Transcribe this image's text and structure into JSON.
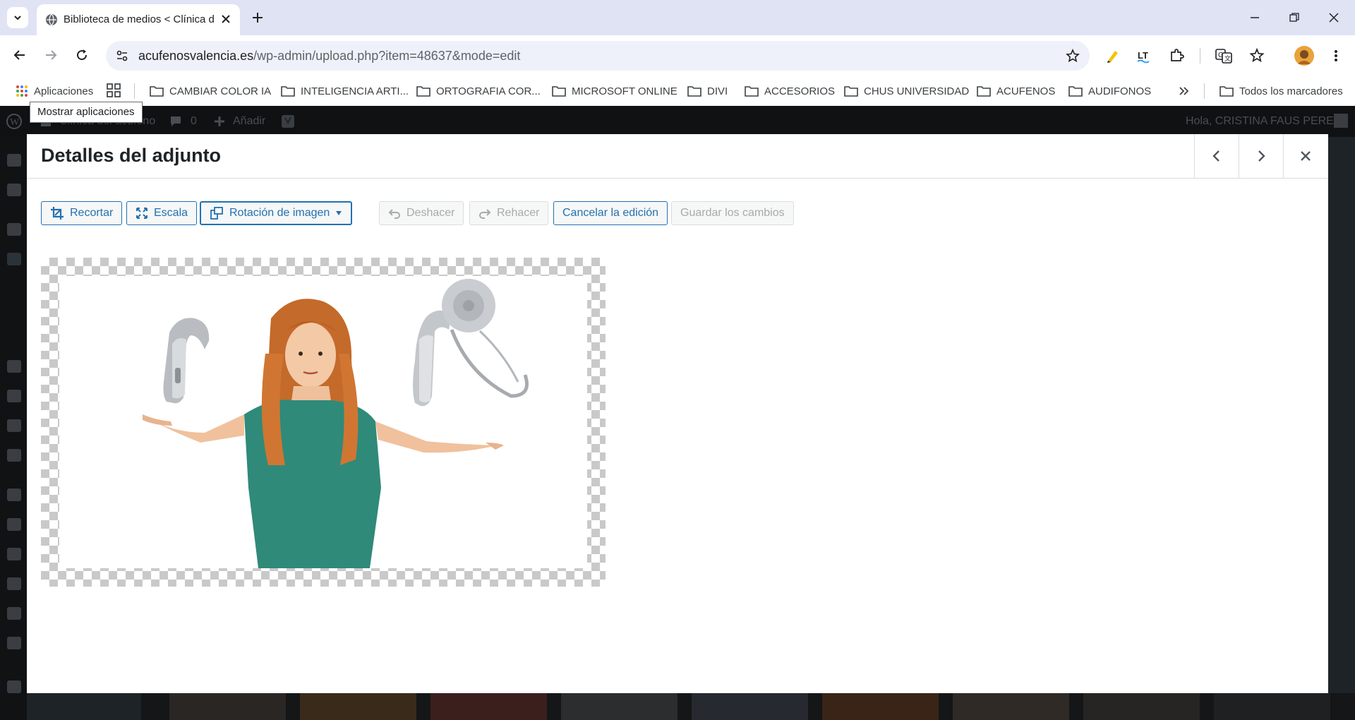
{
  "browser": {
    "tab_title": "Biblioteca de medios < Clínica d",
    "url_host": "acufenosvalencia.es",
    "url_path": "/wp-admin/upload.php?item=48637&mode=edit",
    "bookmarks": [
      {
        "label": "Aplicaciones",
        "icon": "apps-grid-icon"
      },
      {
        "label": "CAMBIAR COLOR IA",
        "icon": "folder-icon"
      },
      {
        "label": "INTELIGENCIA ARTI...",
        "icon": "folder-icon"
      },
      {
        "label": "ORTOGRAFIA COR...",
        "icon": "folder-icon"
      },
      {
        "label": "MICROSOFT ONLINE",
        "icon": "folder-icon"
      },
      {
        "label": "DIVI",
        "icon": "folder-icon"
      },
      {
        "label": "ACCESORIOS",
        "icon": "folder-icon"
      },
      {
        "label": "CHUS UNIVERSIDAD",
        "icon": "folder-icon"
      },
      {
        "label": "ACUFENOS",
        "icon": "folder-icon"
      },
      {
        "label": "AUDIFONOS",
        "icon": "folder-icon"
      }
    ],
    "all_bookmarks": "Todos los marcadores",
    "tooltip": "Mostrar aplicaciones"
  },
  "adminbar": {
    "site": "Clínica del acúfeno",
    "comments": "0",
    "add": "Añadir",
    "greeting": "Hola, CRISTINA FAUS PEREZ"
  },
  "modal": {
    "title": "Detalles del adjunto",
    "toolbar": {
      "crop": "Recortar",
      "scale": "Escala",
      "rotate": "Rotación de imagen",
      "undo": "Deshacer",
      "redo": "Rehacer",
      "cancel": "Cancelar la edición",
      "save": "Guardar los cambios"
    }
  },
  "colors": {
    "wp_blue": "#2271b1",
    "disabled": "#a7aaad",
    "tab_strip": "#dfe3f4"
  }
}
